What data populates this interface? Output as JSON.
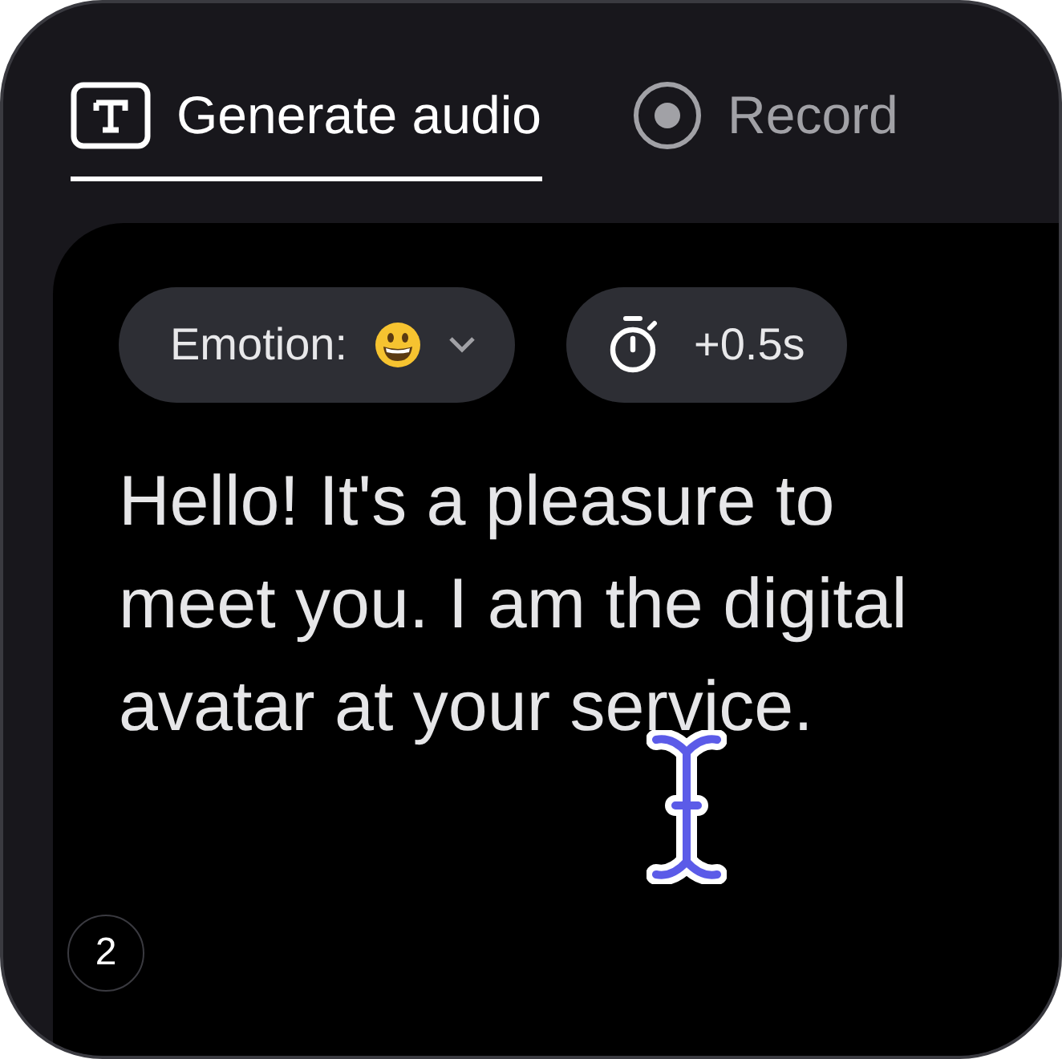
{
  "tabs": [
    {
      "label": "Generate audio",
      "kind": "text",
      "selected": true
    },
    {
      "label": "Record",
      "kind": "record",
      "selected": false
    }
  ],
  "emotion_dropdown": {
    "label": "Emotion:"
  },
  "pause_chip": {
    "label": "+0.5s"
  },
  "text": "Hello! It's a pleasure to meet you. I am the digital avatar at your service.",
  "badge": "2"
}
